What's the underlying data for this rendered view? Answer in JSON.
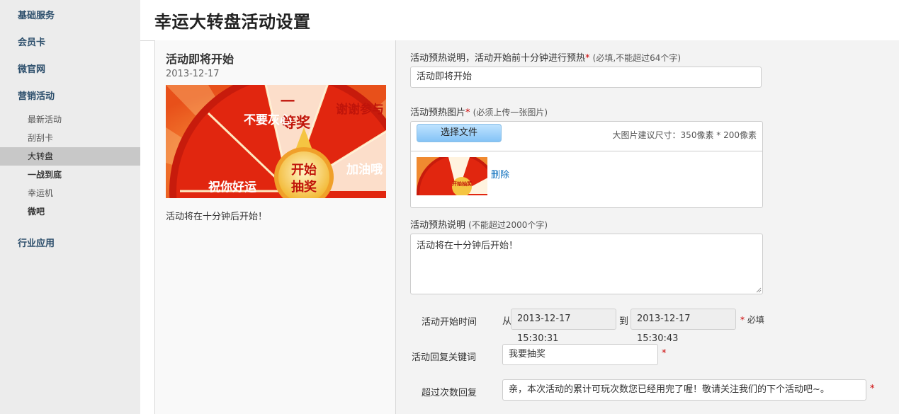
{
  "sidebar": {
    "basic": "基础服务",
    "member_card": "会员卡",
    "micro_site": "微官网",
    "marketing": "营销活动",
    "sub_items": [
      "最新活动",
      "刮刮卡",
      "大转盘",
      "一战到底",
      "幸运机",
      "微吧"
    ],
    "industry": "行业应用"
  },
  "page": {
    "title": "幸运大转盘活动设置"
  },
  "preview": {
    "title": "活动即将开始",
    "date": "2013-12-17",
    "text": "活动将在十分钟后开始！",
    "wheel_segments": [
      "一等奖",
      "谢谢参与",
      "不要灰心",
      "加油哦",
      "祝你好运"
    ],
    "hub_label": "开始抽奖"
  },
  "form": {
    "warmup_desc_label": "活动预热说明，活动开始前十分钟进行预热",
    "warmup_desc_hint": "(必填,不能超过64个字)",
    "warmup_desc_value": "活动即将开始",
    "warmup_img_label": "活动预热图片",
    "warmup_img_hint": "(必须上传一张图片)",
    "choose_file": "选择文件",
    "img_size_hint": "大图片建议尺寸：350像素 * 200像素",
    "delete": "删除",
    "warmup_long_label": "活动预热说明",
    "warmup_long_hint": "(不能超过2000个字)",
    "warmup_long_value": "活动将在十分钟后开始！",
    "start_time_label": "活动开始时间",
    "from": "从",
    "start_value": "2013-12-17 15:30:31",
    "to": "到",
    "end_value": "2013-12-17 15:30:43",
    "required_text": "必填",
    "keyword_label": "活动回复关键词",
    "keyword_value": "我要抽奖",
    "overlimit_label": "超过次数回复",
    "overlimit_value": "亲，本次活动的累计可玩次数您已经用完了喔！敬请关注我们的下个活动吧~。",
    "star": "*"
  },
  "colors": {
    "accent_blue": "#0a6ebd",
    "nav_text": "#2d4f6c",
    "required": "#cc0000",
    "wheel_red": "#e1260f",
    "wheel_gold": "#f5c542"
  }
}
